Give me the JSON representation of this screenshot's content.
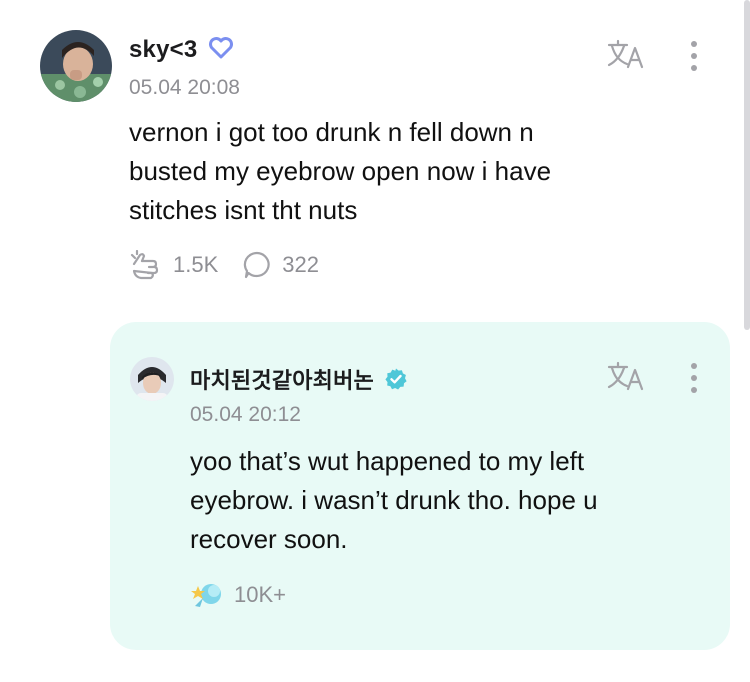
{
  "post": {
    "username": "sky<3",
    "badge_icon": "heart-outline-icon",
    "badge_color": "#7b8ff0",
    "timestamp": "05.04 20:08",
    "text": "vernon i got too drunk n fell down n\nbusted my eyebrow open now i have\nstitches isnt tht nuts",
    "likes": "1.5K",
    "comments": "322",
    "like_icon": "heart-hands-icon",
    "comment_icon": "comment-bubble-icon"
  },
  "reply": {
    "username": "마치된것같아최버논",
    "badge_icon": "verified-check-icon",
    "badge_color": "#4fc7d8",
    "timestamp": "05.04 20:12",
    "text": "yoo that’s wut happened to my left\neyebrow. i wasn’t drunk tho. hope u\nrecover soon.",
    "likes": "10K+",
    "like_icon": "artist-heart-icon",
    "background": "#e8faf6"
  },
  "colors": {
    "muted": "#8e8e93",
    "icon": "#a3a3a8"
  }
}
